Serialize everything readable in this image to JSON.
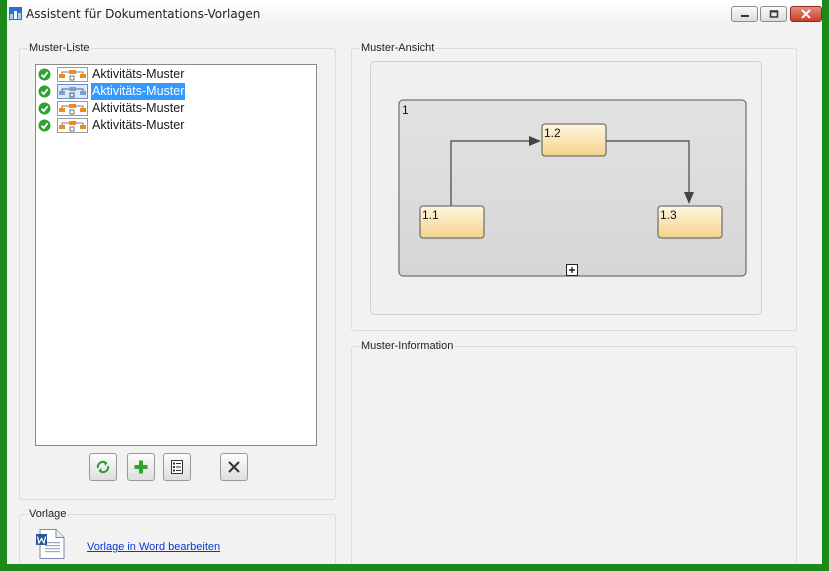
{
  "window": {
    "title": "Assistent für Dokumentations-Vorlagen",
    "minimize_icon": "minimize-icon",
    "maximize_icon": "maximize-icon",
    "close_icon": "close-icon"
  },
  "colors": {
    "frame": "#1b8a1b",
    "selection": "#3399ff",
    "link": "#0b35d6",
    "check": "#2fa32f",
    "node_fill_top": "#fff7e0",
    "node_fill_bottom": "#f4d28a"
  },
  "pattern_list": {
    "label": "Muster-Liste",
    "items": [
      {
        "label": "Aktivitäts-Muster",
        "selected": false,
        "status_icon": "check-icon",
        "type_icon": "activity-pattern-icon"
      },
      {
        "label": "Aktivitäts-Muster",
        "selected": true,
        "status_icon": "check-icon",
        "type_icon": "activity-pattern-icon"
      },
      {
        "label": "Aktivitäts-Muster",
        "selected": false,
        "status_icon": "check-icon",
        "type_icon": "activity-pattern-icon"
      },
      {
        "label": "Aktivitäts-Muster",
        "selected": false,
        "status_icon": "check-icon",
        "type_icon": "activity-pattern-icon"
      }
    ],
    "toolbar": [
      {
        "icon": "refresh-icon"
      },
      {
        "icon": "add-icon"
      },
      {
        "icon": "properties-icon"
      },
      {
        "icon": "delete-icon"
      }
    ]
  },
  "preview": {
    "label": "Muster-Ansicht",
    "container_label": "1",
    "nodes": [
      "1.1",
      "1.2",
      "1.3"
    ],
    "expand_icon": "expand-icon"
  },
  "info": {
    "label": "Muster-Information"
  },
  "template": {
    "label": "Vorlage",
    "icon": "word-document-icon",
    "link": "Vorlage in Word bearbeiten"
  }
}
